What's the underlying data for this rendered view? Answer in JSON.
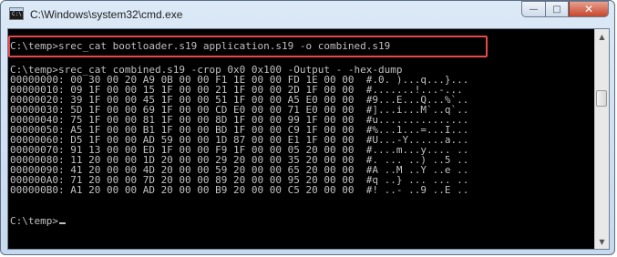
{
  "window": {
    "title": "C:\\Windows\\system32\\cmd.exe",
    "icon_text": "C:\\",
    "controls": {
      "minimize": "—",
      "maximize": "□",
      "close": "✕"
    }
  },
  "console": {
    "lines": [
      "",
      "C:\\temp>srec_cat bootloader.s19 application.s19 -o combined.s19",
      "",
      "C:\\temp>srec_cat combined.s19 -crop 0x0 0x100 -Output - -hex-dump",
      "00000000: 00 30 00 20 A9 0B 00 00 F1 1E 00 00 FD 1E 00 00  #.0. )...q...}...",
      "00000010: 09 1F 00 00 15 1F 00 00 21 1F 00 00 2D 1F 00 00  #.......!...-...",
      "00000020: 39 1F 00 00 45 1F 00 00 51 1F 00 00 A5 E0 00 00  #9...E...Q...%`..",
      "00000030: 5D 1F 00 00 69 1F 00 00 CD E0 00 00 71 E0 00 00  #]...i...M`..q`..",
      "00000040: 75 1F 00 00 81 1F 00 00 8D 1F 00 00 99 1F 00 00  #u...............",
      "00000050: A5 1F 00 00 B1 1F 00 00 BD 1F 00 00 C9 1F 00 00  #%...1...=...I...",
      "00000060: D5 1F 00 00 AD 59 00 00 1D 87 00 00 E1 1F 00 00  #U...-Y......a...",
      "00000070: 91 13 00 00 ED 1F 00 00 F9 1F 00 00 05 20 00 00  #....m...y.... ..",
      "00000080: 11 20 00 00 1D 20 00 00 29 20 00 00 35 20 00 00  #. ... ..) ..5 ..",
      "00000090: 41 20 00 00 4D 20 00 00 59 20 00 00 65 20 00 00  #A ..M ..Y ..e ..",
      "000000A0: 71 20 00 00 7D 20 00 00 89 20 00 00 95 20 00 00  #q ..} ... ... ..",
      "000000B0: A1 20 00 00 AD 20 00 00 B9 20 00 00 C5 20 00 00  #! ..- ..9 ..E ..",
      "",
      "C:\\temp>"
    ]
  },
  "icons": {
    "app": "console-app-icon",
    "scroll_up": "scroll-up-arrow-icon",
    "scroll_down": "scroll-down-arrow-icon"
  },
  "colors": {
    "console_bg": "#000000",
    "console_text": "#c0c0c0",
    "highlight_box": "#e8474c",
    "close_button": "#c7462e"
  }
}
